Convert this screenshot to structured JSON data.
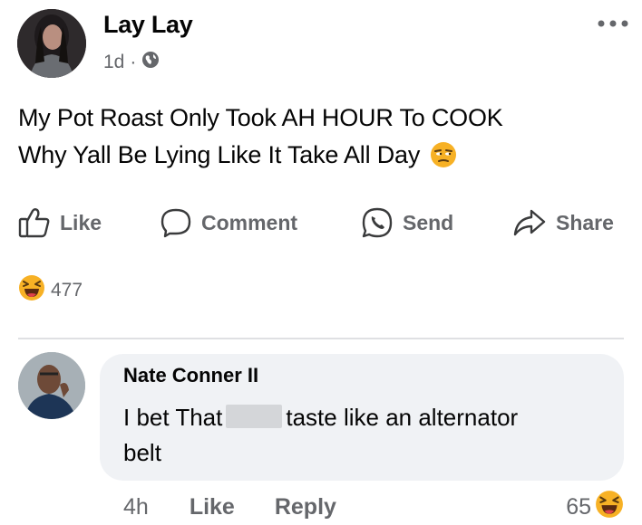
{
  "post": {
    "author_name": "Lay Lay",
    "time": "1d",
    "separator": "·",
    "audience_icon": "globe-icon",
    "more_icon": "more-dots-icon",
    "line1": "My Pot Roast Only Took AH HOUR To COOK",
    "line2": "Why Yall Be Lying Like It Take All Day",
    "line2_emoji": "unamused-face-emoji"
  },
  "actions": {
    "like": "Like",
    "comment": "Comment",
    "send": "Send",
    "share": "Share"
  },
  "reactions": {
    "emoji": "laughing-emoji",
    "count": "477"
  },
  "comment": {
    "author_name": "Nate Conner II",
    "text_before": "I bet That",
    "text_after": "taste like an alternator",
    "text_line2": "belt",
    "time": "4h",
    "like": "Like",
    "reply": "Reply",
    "reaction_count": "65",
    "reaction_emoji": "laughing-emoji"
  },
  "colors": {
    "secondary_text": "#65676b",
    "bubble": "#f0f2f5",
    "emoji_yellow": "#f7b125"
  }
}
